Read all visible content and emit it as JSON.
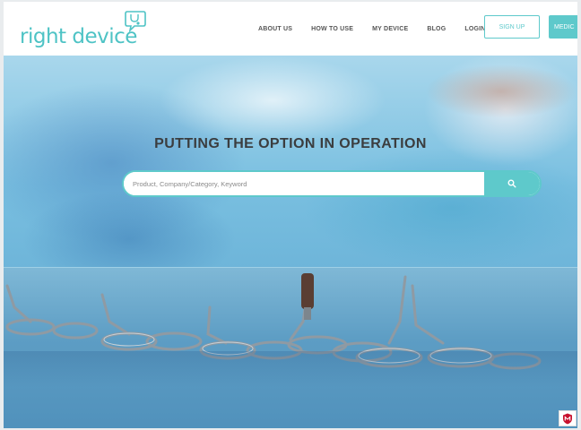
{
  "brand": {
    "name": "right device",
    "color": "#5ec9cb"
  },
  "nav": {
    "items": [
      {
        "label": "ABOUT US"
      },
      {
        "label": "HOW TO USE"
      },
      {
        "label": "MY DEVICE"
      },
      {
        "label": "BLOG"
      },
      {
        "label": "LOGIN"
      }
    ],
    "signup_label": "SIGN UP",
    "medic_label": "MEDIC"
  },
  "hero": {
    "title": "PUTTING THE OPTION IN OPERATION",
    "image_subject": "surgical instruments on blue drape",
    "search": {
      "placeholder": "Product, Company/Category, Keyword",
      "button_icon": "search-icon"
    }
  },
  "badge": {
    "icon": "mcafee-shield-icon",
    "color": "#c8102e"
  }
}
